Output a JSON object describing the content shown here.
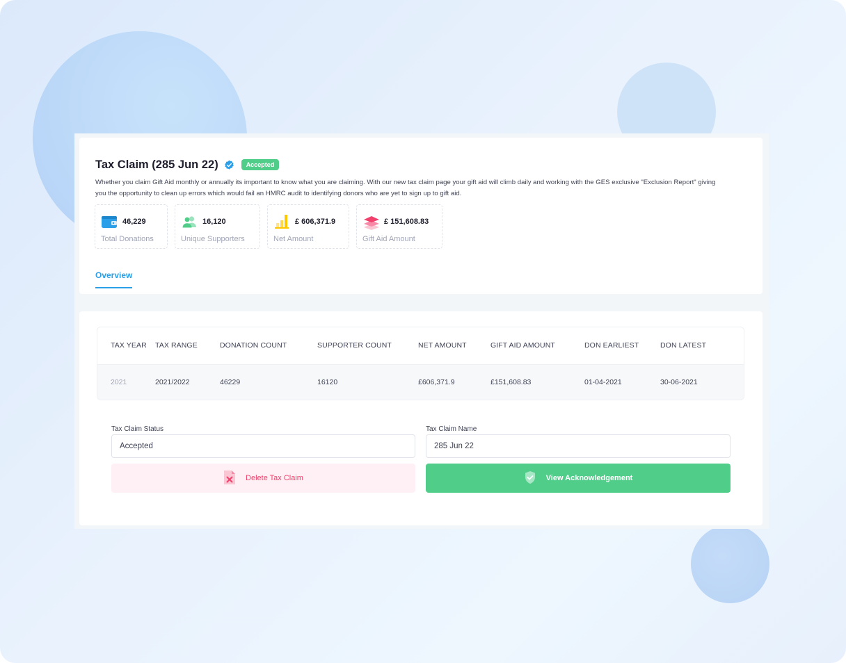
{
  "header": {
    "title": "Tax Claim (285 Jun 22)",
    "status_badge": "Accepted",
    "description": "Whether you claim Gift Aid monthly or annually its important to know what you are claiming. With our new tax claim page your gift aid will climb daily and working with the GES exclusive \"Exclusion Report\" giving you the opportunity to clean up errors which would fail an HMRC audit to identifying donors who are yet to sign up to gift aid."
  },
  "stats": [
    {
      "value": "46,229",
      "label": "Total Donations",
      "icon": "wallet-icon"
    },
    {
      "value": "16,120",
      "label": "Unique Supporters",
      "icon": "users-icon"
    },
    {
      "value": "£ 606,371.9",
      "label": "Net Amount",
      "icon": "bar-chart-icon"
    },
    {
      "value": "£ 151,608.83",
      "label": "Gift Aid Amount",
      "icon": "layers-icon"
    }
  ],
  "tabs": [
    {
      "label": "Overview"
    }
  ],
  "table": {
    "columns": [
      "TAX YEAR",
      "TAX RANGE",
      "DONATION COUNT",
      "SUPPORTER COUNT",
      "NET AMOUNT",
      "GIFT AID AMOUNT",
      "DON EARLIEST",
      "DON LATEST"
    ],
    "rows": [
      [
        "2021",
        "2021/2022",
        "46229",
        "16120",
        "£606,371.9",
        "£151,608.83",
        "01-04-2021",
        "30-06-2021"
      ]
    ]
  },
  "form": {
    "status_label": "Tax Claim Status",
    "status_value": "Accepted",
    "name_label": "Tax Claim Name",
    "name_value": "285 Jun 22",
    "delete_label": "Delete Tax Claim",
    "ack_label": "View Acknowledgement"
  },
  "colors": {
    "accent": "#2b9fe8",
    "success": "#50cd89",
    "danger": "#f1416c"
  }
}
